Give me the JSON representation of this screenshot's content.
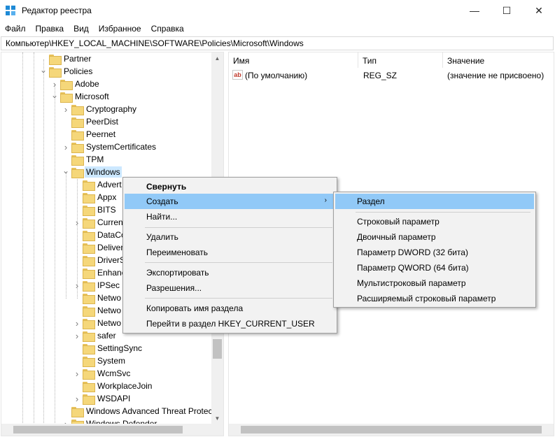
{
  "window": {
    "title": "Редактор реестра",
    "controls": {
      "minimize": "—",
      "maximize": "☐",
      "close": "✕"
    }
  },
  "menu": [
    "Файл",
    "Правка",
    "Вид",
    "Избранное",
    "Справка"
  ],
  "address": "Компьютер\\HKEY_LOCAL_MACHINE\\SOFTWARE\\Policies\\Microsoft\\Windows",
  "tree": [
    {
      "label": "Partner",
      "level": 1,
      "expander": "none"
    },
    {
      "label": "Policies",
      "level": 1,
      "expander": "open"
    },
    {
      "label": "Adobe",
      "level": 2,
      "expander": "closed"
    },
    {
      "label": "Microsoft",
      "level": 2,
      "expander": "open"
    },
    {
      "label": "Cryptography",
      "level": 3,
      "expander": "closed"
    },
    {
      "label": "PeerDist",
      "level": 3,
      "expander": "none"
    },
    {
      "label": "Peernet",
      "level": 3,
      "expander": "none"
    },
    {
      "label": "SystemCertificates",
      "level": 3,
      "expander": "closed"
    },
    {
      "label": "TPM",
      "level": 3,
      "expander": "none"
    },
    {
      "label": "Windows",
      "level": 3,
      "expander": "open",
      "selected": true
    },
    {
      "label": "Advert",
      "level": 4,
      "expander": "none"
    },
    {
      "label": "Appx",
      "level": 4,
      "expander": "none"
    },
    {
      "label": "BITS",
      "level": 4,
      "expander": "none"
    },
    {
      "label": "Curren",
      "level": 4,
      "expander": "closed"
    },
    {
      "label": "DataCo",
      "level": 4,
      "expander": "none"
    },
    {
      "label": "Deliver",
      "level": 4,
      "expander": "none"
    },
    {
      "label": "DriverS",
      "level": 4,
      "expander": "none"
    },
    {
      "label": "Enhanc",
      "level": 4,
      "expander": "none"
    },
    {
      "label": "IPSec",
      "level": 4,
      "expander": "closed"
    },
    {
      "label": "Netwo",
      "level": 4,
      "expander": "none"
    },
    {
      "label": "Netwo",
      "level": 4,
      "expander": "none"
    },
    {
      "label": "Netwo",
      "level": 4,
      "expander": "closed"
    },
    {
      "label": "safer",
      "level": 4,
      "expander": "closed"
    },
    {
      "label": "SettingSync",
      "level": 4,
      "expander": "none"
    },
    {
      "label": "System",
      "level": 4,
      "expander": "none"
    },
    {
      "label": "WcmSvc",
      "level": 4,
      "expander": "closed"
    },
    {
      "label": "WorkplaceJoin",
      "level": 4,
      "expander": "none"
    },
    {
      "label": "WSDAPI",
      "level": 4,
      "expander": "closed"
    },
    {
      "label": "Windows Advanced Threat Protec",
      "level": 3,
      "expander": "none"
    },
    {
      "label": "Windows Defender",
      "level": 3,
      "expander": "closed"
    }
  ],
  "values": {
    "columns": [
      "Имя",
      "Тип",
      "Значение"
    ],
    "rows": [
      {
        "name": "(По умолчанию)",
        "type": "REG_SZ",
        "data": "(значение не присвоено)"
      }
    ]
  },
  "context_menu": {
    "collapse": "Свернуть",
    "create": "Создать",
    "find": "Найти...",
    "delete": "Удалить",
    "rename": "Переименовать",
    "export": "Экспортировать",
    "permissions": "Разрешения...",
    "copy_key_name": "Копировать имя раздела",
    "go_to_hkcu": "Перейти в раздел HKEY_CURRENT_USER"
  },
  "submenu": {
    "key": "Раздел",
    "string": "Строковый параметр",
    "binary": "Двоичный параметр",
    "dword": "Параметр DWORD (32 бита)",
    "qword": "Параметр QWORD (64 бита)",
    "multi_string": "Мультистроковый параметр",
    "expandable_string": "Расширяемый строковый параметр"
  },
  "colors": {
    "highlight": "#91c9f7",
    "selection": "#cce8ff",
    "folder": "#f5d77a"
  }
}
